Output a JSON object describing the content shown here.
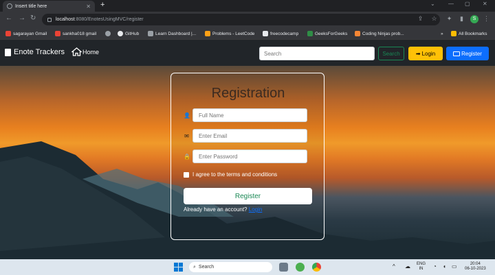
{
  "browser": {
    "tab_title": "Insert title here",
    "url_host": "localhost",
    "url_path": ":8080/EnotesUsingMVC/register",
    "bookmarks": [
      {
        "label": "sagarayan Gmail",
        "color": "#ea4335"
      },
      {
        "label": "sankha018 gmail",
        "color": "#ea4335"
      },
      {
        "label": "",
        "color": "#9aa0a6"
      },
      {
        "label": "GitHub",
        "color": "#e8eaed"
      },
      {
        "label": "Learn Dashboard |...",
        "color": "#9aa0a6"
      },
      {
        "label": "Problems - LeetCode",
        "color": "#ffa116"
      },
      {
        "label": "freecodecamp",
        "color": "#e8eaed"
      },
      {
        "label": "GeeksForGeeks",
        "color": "#2f8d46"
      },
      {
        "label": "Coding Ninjas prob...",
        "color": "#f58634"
      }
    ],
    "all_bookmarks": "All Bookmarks",
    "profile_initial": "S"
  },
  "navbar": {
    "brand": "Enote Trackers",
    "home": "Home",
    "search_placeholder": "Search",
    "search_button": "Search",
    "login_button": "Login",
    "register_button": "Register"
  },
  "form": {
    "title": "Registration",
    "fullname_placeholder": "Full Name",
    "email_placeholder": "Enter Email",
    "password_placeholder": "Enter Password",
    "agree_label": "I agree to the terms and conditions",
    "submit_label": "Register",
    "have_account": "Already have an account?",
    "login_link": "Login"
  },
  "taskbar": {
    "search_placeholder": "Search",
    "lang_top": "ENG",
    "lang_bottom": "IN",
    "time": "20:04",
    "date": "06-10-2023"
  }
}
